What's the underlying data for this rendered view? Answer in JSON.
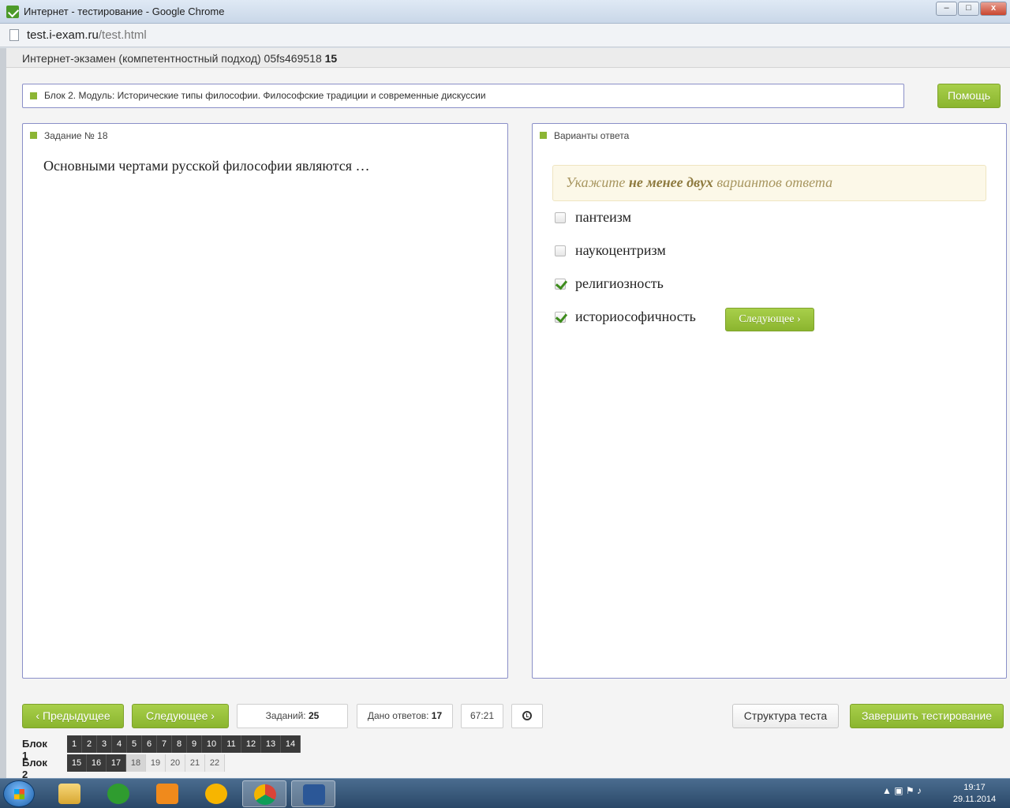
{
  "window": {
    "title": "Интернет - тестирование - Google Chrome",
    "controls": {
      "minimize": "–",
      "maximize": "□",
      "close": "x"
    }
  },
  "address": {
    "host": "test.i-exam.ru",
    "path": "/test.html"
  },
  "exam": {
    "title": "Интернет-экзамен (компетентностный подход) 05fs469518",
    "number": "15"
  },
  "block": {
    "title": "Блок 2. Модуль: Исторические типы философии. Философские традиции и современные дискуссии"
  },
  "help_label": "Помощь",
  "task": {
    "header": "Задание № 18",
    "question": "Основными чертами русской философии являются …"
  },
  "answers": {
    "header": "Варианты ответа",
    "hint_pre": "Укажите ",
    "hint_bold": "не менее двух",
    "hint_post": " вариантов ответа",
    "options": [
      {
        "label": "пантеизм",
        "checked": false
      },
      {
        "label": "наукоцентризм",
        "checked": false
      },
      {
        "label": "религиозность",
        "checked": true
      },
      {
        "label": "историософичность",
        "checked": true
      }
    ],
    "next_label": "Следующее"
  },
  "nav": {
    "prev_label": "Предыдущее",
    "next_label": "Следующее",
    "tasks_label": "Заданий:",
    "tasks_value": "25",
    "answered_label": "Дано ответов:",
    "answered_value": "17",
    "timer": "67:21",
    "structure_label": "Структура теста",
    "finish_label": "Завершить тестирование"
  },
  "blocks": [
    {
      "label": "Блок 1",
      "items": [
        "1",
        "2",
        "3",
        "4",
        "5",
        "6",
        "7",
        "8",
        "9",
        "10",
        "11",
        "12",
        "13",
        "14"
      ]
    },
    {
      "label": "Блок 2",
      "items": [
        "15",
        "16",
        "17",
        "18",
        "19",
        "20",
        "21",
        "22"
      ]
    }
  ],
  "current_task": "18",
  "answered_tasks": [
    "1",
    "2",
    "3",
    "4",
    "5",
    "6",
    "7",
    "8",
    "9",
    "10",
    "11",
    "12",
    "13",
    "14",
    "15",
    "16",
    "17"
  ],
  "taskbar": {
    "time": "19:17",
    "date": "29.11.2014"
  },
  "colors": {
    "accent_green": "#8cb534",
    "panel_border": "#8a8fc8",
    "check_green": "#3d8b1c"
  }
}
